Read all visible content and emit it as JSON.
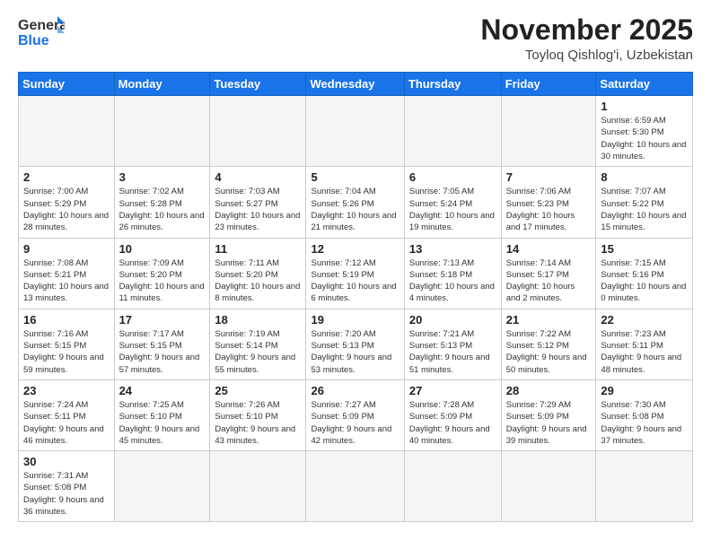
{
  "logo": {
    "text_general": "General",
    "text_blue": "Blue"
  },
  "title": "November 2025",
  "subtitle": "Toyloq Qishlog'i, Uzbekistan",
  "weekdays": [
    "Sunday",
    "Monday",
    "Tuesday",
    "Wednesday",
    "Thursday",
    "Friday",
    "Saturday"
  ],
  "weeks": [
    [
      {
        "day": "",
        "info": ""
      },
      {
        "day": "",
        "info": ""
      },
      {
        "day": "",
        "info": ""
      },
      {
        "day": "",
        "info": ""
      },
      {
        "day": "",
        "info": ""
      },
      {
        "day": "",
        "info": ""
      },
      {
        "day": "1",
        "info": "Sunrise: 6:59 AM\nSunset: 5:30 PM\nDaylight: 10 hours and 30 minutes."
      }
    ],
    [
      {
        "day": "2",
        "info": "Sunrise: 7:00 AM\nSunset: 5:29 PM\nDaylight: 10 hours and 28 minutes."
      },
      {
        "day": "3",
        "info": "Sunrise: 7:02 AM\nSunset: 5:28 PM\nDaylight: 10 hours and 26 minutes."
      },
      {
        "day": "4",
        "info": "Sunrise: 7:03 AM\nSunset: 5:27 PM\nDaylight: 10 hours and 23 minutes."
      },
      {
        "day": "5",
        "info": "Sunrise: 7:04 AM\nSunset: 5:26 PM\nDaylight: 10 hours and 21 minutes."
      },
      {
        "day": "6",
        "info": "Sunrise: 7:05 AM\nSunset: 5:24 PM\nDaylight: 10 hours and 19 minutes."
      },
      {
        "day": "7",
        "info": "Sunrise: 7:06 AM\nSunset: 5:23 PM\nDaylight: 10 hours and 17 minutes."
      },
      {
        "day": "8",
        "info": "Sunrise: 7:07 AM\nSunset: 5:22 PM\nDaylight: 10 hours and 15 minutes."
      }
    ],
    [
      {
        "day": "9",
        "info": "Sunrise: 7:08 AM\nSunset: 5:21 PM\nDaylight: 10 hours and 13 minutes."
      },
      {
        "day": "10",
        "info": "Sunrise: 7:09 AM\nSunset: 5:20 PM\nDaylight: 10 hours and 11 minutes."
      },
      {
        "day": "11",
        "info": "Sunrise: 7:11 AM\nSunset: 5:20 PM\nDaylight: 10 hours and 8 minutes."
      },
      {
        "day": "12",
        "info": "Sunrise: 7:12 AM\nSunset: 5:19 PM\nDaylight: 10 hours and 6 minutes."
      },
      {
        "day": "13",
        "info": "Sunrise: 7:13 AM\nSunset: 5:18 PM\nDaylight: 10 hours and 4 minutes."
      },
      {
        "day": "14",
        "info": "Sunrise: 7:14 AM\nSunset: 5:17 PM\nDaylight: 10 hours and 2 minutes."
      },
      {
        "day": "15",
        "info": "Sunrise: 7:15 AM\nSunset: 5:16 PM\nDaylight: 10 hours and 0 minutes."
      }
    ],
    [
      {
        "day": "16",
        "info": "Sunrise: 7:16 AM\nSunset: 5:15 PM\nDaylight: 9 hours and 59 minutes."
      },
      {
        "day": "17",
        "info": "Sunrise: 7:17 AM\nSunset: 5:15 PM\nDaylight: 9 hours and 57 minutes."
      },
      {
        "day": "18",
        "info": "Sunrise: 7:19 AM\nSunset: 5:14 PM\nDaylight: 9 hours and 55 minutes."
      },
      {
        "day": "19",
        "info": "Sunrise: 7:20 AM\nSunset: 5:13 PM\nDaylight: 9 hours and 53 minutes."
      },
      {
        "day": "20",
        "info": "Sunrise: 7:21 AM\nSunset: 5:13 PM\nDaylight: 9 hours and 51 minutes."
      },
      {
        "day": "21",
        "info": "Sunrise: 7:22 AM\nSunset: 5:12 PM\nDaylight: 9 hours and 50 minutes."
      },
      {
        "day": "22",
        "info": "Sunrise: 7:23 AM\nSunset: 5:11 PM\nDaylight: 9 hours and 48 minutes."
      }
    ],
    [
      {
        "day": "23",
        "info": "Sunrise: 7:24 AM\nSunset: 5:11 PM\nDaylight: 9 hours and 46 minutes."
      },
      {
        "day": "24",
        "info": "Sunrise: 7:25 AM\nSunset: 5:10 PM\nDaylight: 9 hours and 45 minutes."
      },
      {
        "day": "25",
        "info": "Sunrise: 7:26 AM\nSunset: 5:10 PM\nDaylight: 9 hours and 43 minutes."
      },
      {
        "day": "26",
        "info": "Sunrise: 7:27 AM\nSunset: 5:09 PM\nDaylight: 9 hours and 42 minutes."
      },
      {
        "day": "27",
        "info": "Sunrise: 7:28 AM\nSunset: 5:09 PM\nDaylight: 9 hours and 40 minutes."
      },
      {
        "day": "28",
        "info": "Sunrise: 7:29 AM\nSunset: 5:09 PM\nDaylight: 9 hours and 39 minutes."
      },
      {
        "day": "29",
        "info": "Sunrise: 7:30 AM\nSunset: 5:08 PM\nDaylight: 9 hours and 37 minutes."
      }
    ],
    [
      {
        "day": "30",
        "info": "Sunrise: 7:31 AM\nSunset: 5:08 PM\nDaylight: 9 hours and 36 minutes."
      },
      {
        "day": "",
        "info": ""
      },
      {
        "day": "",
        "info": ""
      },
      {
        "day": "",
        "info": ""
      },
      {
        "day": "",
        "info": ""
      },
      {
        "day": "",
        "info": ""
      },
      {
        "day": "",
        "info": ""
      }
    ]
  ]
}
